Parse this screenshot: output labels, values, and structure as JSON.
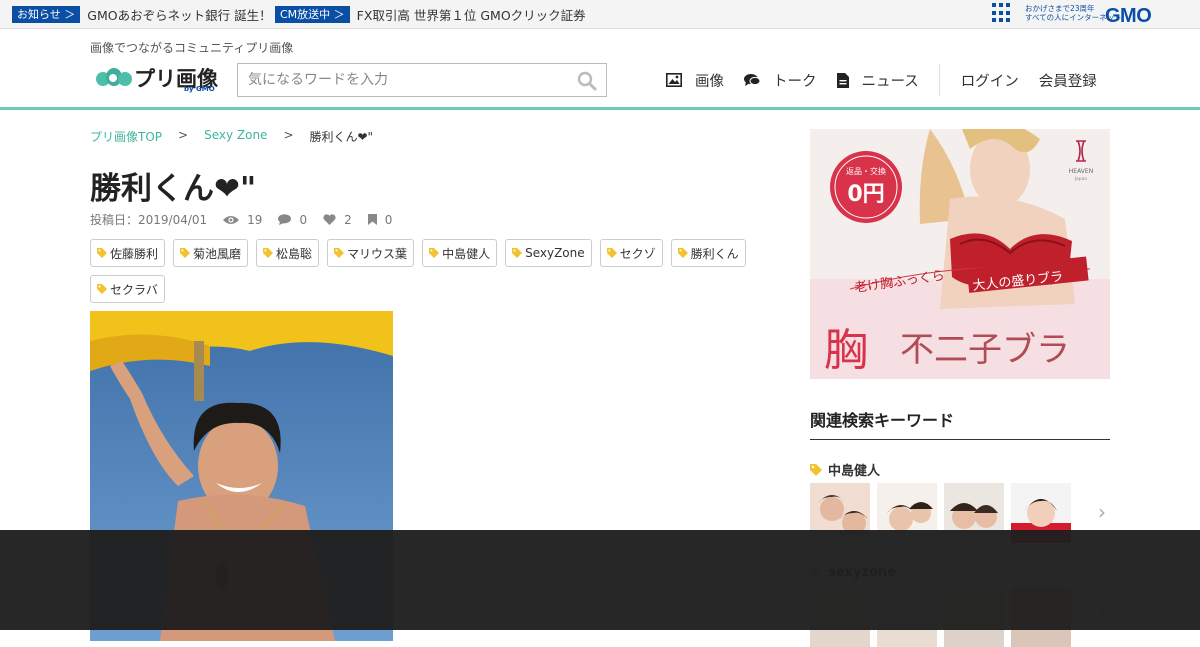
{
  "topbar": {
    "news": [
      {
        "badge": "お知らせ ＞",
        "text": "GMOあおぞらネット銀行 誕生！"
      },
      {
        "badge": "CM放送中 ＞",
        "text": "FX取引高 世界第１位 GMOクリック証券"
      }
    ],
    "slogan_line1": "おかげさまで23周年",
    "slogan_line2": "すべての人にインターネット",
    "brand": "GMO"
  },
  "header": {
    "tagline": "画像でつながるコミュニティプリ画像",
    "logo_text": "プリ画像",
    "logo_by": "by GMO",
    "search_placeholder": "気になるワードを入力",
    "nav": [
      {
        "label": "画像",
        "icon": "image-icon"
      },
      {
        "label": "トーク",
        "icon": "comment-icon"
      },
      {
        "label": "ニュース",
        "icon": "document-icon"
      }
    ],
    "login": "ログイン",
    "register": "会員登録"
  },
  "breadcrumb": {
    "home": "プリ画像TOP",
    "category": "Sexy Zone",
    "current": "勝利くん❤︎\""
  },
  "post": {
    "title": "勝利くん❤︎\"",
    "date": "投稿日：2019/04/01",
    "views": "19",
    "comments": "0",
    "likes": "2",
    "bookmarks": "0",
    "tags": [
      "佐藤勝利",
      "菊池風磨",
      "松島聡",
      "マリウス葉",
      "中島健人",
      "SexyZone",
      "セクゾ",
      "勝利くん",
      "セクラバ"
    ]
  },
  "ad": {
    "price_label": "返品・交換",
    "price": "0円",
    "brand": "HEAVEN",
    "brand_sub": "Japan",
    "line1": "老け胸ふっくら",
    "line2": "大人の盛りブラ",
    "headline_main": "胸",
    "headline_rest": "不二子ブラ"
  },
  "sidebar": {
    "keywords_title": "関連検索キーワード",
    "groups": [
      {
        "label": "中島健人"
      },
      {
        "label": "sexyzone"
      }
    ]
  },
  "colors": {
    "accent": "#6ccbb5",
    "link": "#3fb59e",
    "gmo_blue": "#0b4fa5",
    "tag_icon": "#f2c230"
  }
}
